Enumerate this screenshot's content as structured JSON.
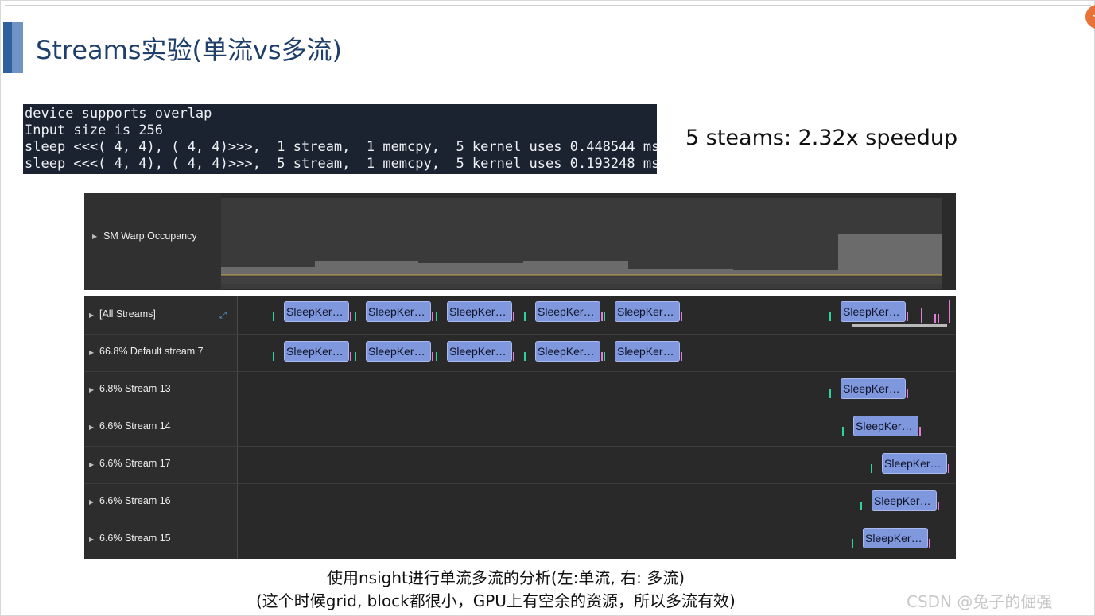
{
  "slide": {
    "title": "Streams实验(单流vs多流)",
    "speedup_note": "5 steams: 2.32x speedup"
  },
  "terminal": {
    "lines": [
      "device supports overlap",
      "Input size is 256",
      "sleep <<<( 4, 4), ( 4, 4)>>>,  1 stream,  1 memcpy,  5 kernel uses 0.448544 ms",
      "sleep <<<( 4, 4), ( 4, 4)>>>,  5 stream,  1 memcpy,  5 kernel uses 0.193248 ms"
    ]
  },
  "occupancy": {
    "label": "SM Warp Occupancy",
    "levels": [
      0.1,
      0.18,
      0.15,
      0.18,
      0.07,
      0.06,
      0.52
    ]
  },
  "timeline": {
    "kernel_label": "SleepKer…",
    "rows": [
      {
        "label": "[All Streams]",
        "kernel_count": 6
      },
      {
        "label": "66.8% Default stream 7",
        "kernel_count": 5
      },
      {
        "label": "6.8% Stream 13",
        "kernel_count": 1
      },
      {
        "label": "6.6% Stream 14",
        "kernel_count": 1
      },
      {
        "label": "6.6% Stream 17",
        "kernel_count": 1
      },
      {
        "label": "6.6% Stream 16",
        "kernel_count": 1
      },
      {
        "label": "6.6% Stream 15",
        "kernel_count": 1
      }
    ]
  },
  "caption": {
    "line1": "使用nsight进行单流多流的分析(左:单流, 右: 多流)",
    "line2": "(这个时候grid, block都很小，GPU上有空余的资源，所以多流有效)"
  },
  "watermark": "CSDN @兔子的倔强",
  "colors": {
    "kernel_fill": "#7f97dc",
    "memcpy_tick": "#2fd39a",
    "sync_tick": "#e57ad9",
    "title_color": "#1f3f6b"
  },
  "icons": {
    "expand": "expand-diagonal-icon",
    "row_caret": "caret-right-icon"
  }
}
